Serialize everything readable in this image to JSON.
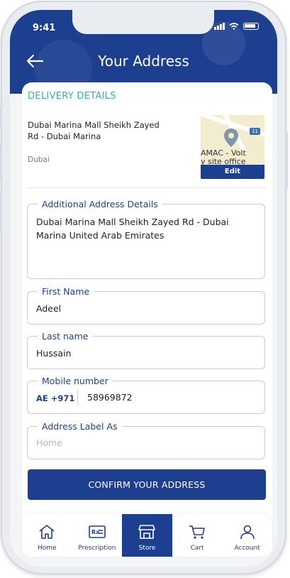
{
  "status_bar": {
    "time": "9:41"
  },
  "header": {
    "title": "Your Address"
  },
  "delivery": {
    "section_title": "DELIVERY DETAILS",
    "address": "Dubai Marina Mall  Sheikh Zayed Rd - Dubai Marina",
    "city": "Dubai",
    "map_label": "AMAC - Volt\ny site office",
    "map_badge": "11",
    "edit_label": "Edit"
  },
  "form": {
    "additional": {
      "label": "Additional Address Details",
      "value": "Dubai Marina Mall  Sheikh Zayed Rd - Dubai Marina United Arab Emirates"
    },
    "first_name": {
      "label": "First Name",
      "value": "Adeel"
    },
    "last_name": {
      "label": "Last name",
      "value": "Hussain"
    },
    "mobile": {
      "label": "Mobile number",
      "country_code": "AE +971",
      "value": "58969872"
    },
    "address_label": {
      "label": "Address Label As",
      "placeholder": "Home"
    },
    "confirm_label": "CONFIRM YOUR ADDRESS"
  },
  "nav": {
    "items": [
      {
        "label": "Home",
        "icon": "home-icon"
      },
      {
        "label": "Prescription",
        "icon": "prescription-icon"
      },
      {
        "label": "Store",
        "icon": "store-icon",
        "active": true
      },
      {
        "label": "Cart",
        "icon": "cart-icon"
      },
      {
        "label": "Account",
        "icon": "account-icon"
      }
    ]
  },
  "colors": {
    "brand": "#1d3f8f",
    "accent": "#2cb6b0"
  }
}
